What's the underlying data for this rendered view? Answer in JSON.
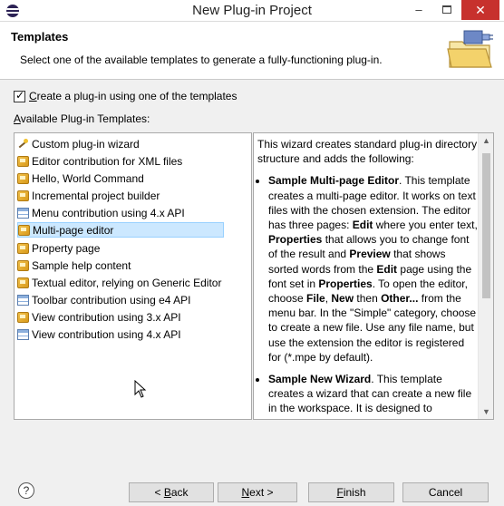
{
  "window": {
    "title": "New Plug-in Project",
    "minimize": "–",
    "close": "✕"
  },
  "header": {
    "title": "Templates",
    "description": "Select one of the available templates to generate a fully-functioning plug-in."
  },
  "checkbox": {
    "mnemonic": "C",
    "label_rest": "reate a plug-in using one of the templates",
    "checked": true
  },
  "available_label": {
    "mnemonic": "A",
    "rest": "vailable Plug-in Templates:"
  },
  "templates": [
    {
      "label": "Custom plug-in wizard",
      "icon": "wand-icon"
    },
    {
      "label": "Editor contribution for XML files",
      "icon": "plugin-icon"
    },
    {
      "label": "Hello, World Command",
      "icon": "plugin-icon"
    },
    {
      "label": "Incremental project builder",
      "icon": "plugin-icon"
    },
    {
      "label": "Menu contribution using 4.x API",
      "icon": "table-icon"
    },
    {
      "label": "Multi-page editor",
      "icon": "plugin-icon",
      "selected": true
    },
    {
      "label": "Property page",
      "icon": "plugin-icon"
    },
    {
      "label": "Sample help content",
      "icon": "plugin-icon"
    },
    {
      "label": "Textual editor, relying on Generic Editor",
      "icon": "plugin-icon"
    },
    {
      "label": "Toolbar contribution using e4 API",
      "icon": "table-icon"
    },
    {
      "label": "View contribution using 3.x API",
      "icon": "plugin-icon"
    },
    {
      "label": "View contribution using 4.x API",
      "icon": "table-icon"
    }
  ],
  "description": {
    "intro": "This wizard creates standard plug-in directory structure and adds the following:",
    "item1": {
      "title": "Sample Multi-page Editor",
      "t1": ". This template creates a multi-page editor. It works on text files with the chosen extension. The editor has three pages: ",
      "b1": "Edit",
      "t2": " where you enter text, ",
      "b2": "Properties",
      "t3": " that allows you to change font of the result and ",
      "b3": "Preview",
      "t4": " that shows sorted words from the ",
      "b4": "Edit",
      "t5": " page using the font set in ",
      "b5": "Properties",
      "t6": ". To open the editor, choose ",
      "b6": "File",
      "t7": ", ",
      "b7": "New",
      "t8": " then ",
      "b8": "Other...",
      "t9": " from the menu bar. In the \"Simple\" category, choose to create a new file. Use any file name, but use the extension the editor is registered for (*.mpe by default)."
    },
    "item2": {
      "title": "Sample New Wizard",
      "t1": ". This template creates a wizard that can create a new file in the workspace. It is designed to generate files that can be opened by a"
    }
  },
  "buttons": {
    "help": "?",
    "back_mnemonic": "B",
    "back_prefix": "< ",
    "back_rest": "ack",
    "next_mnemonic": "N",
    "next_rest": "ext >",
    "finish_mnemonic": "F",
    "finish_rest": "inish",
    "cancel": "Cancel"
  }
}
